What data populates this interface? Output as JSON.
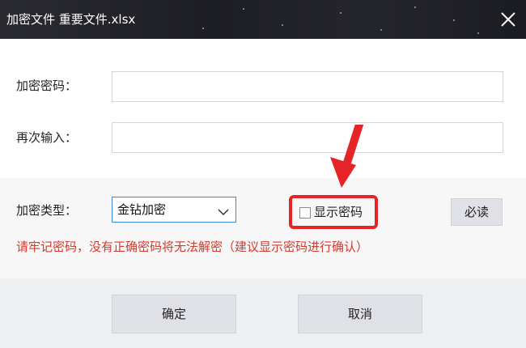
{
  "window": {
    "title": "加密文件  重要文件.xlsx",
    "close_icon": "close-icon"
  },
  "form": {
    "password_label": "加密密码：",
    "password_value": "",
    "confirm_label": "再次输入：",
    "confirm_value": "",
    "type_label": "加密类型：",
    "type_selected": "金钻加密",
    "show_password_label": "显示密码",
    "show_password_checked": false,
    "must_read_button": "必读",
    "warning_text": "请牢记密码，没有正确密码将无法解密（建议显示密码进行确认）"
  },
  "actions": {
    "ok_label": "确定",
    "cancel_label": "取消"
  },
  "annotation": {
    "highlight_color": "#e42426"
  }
}
